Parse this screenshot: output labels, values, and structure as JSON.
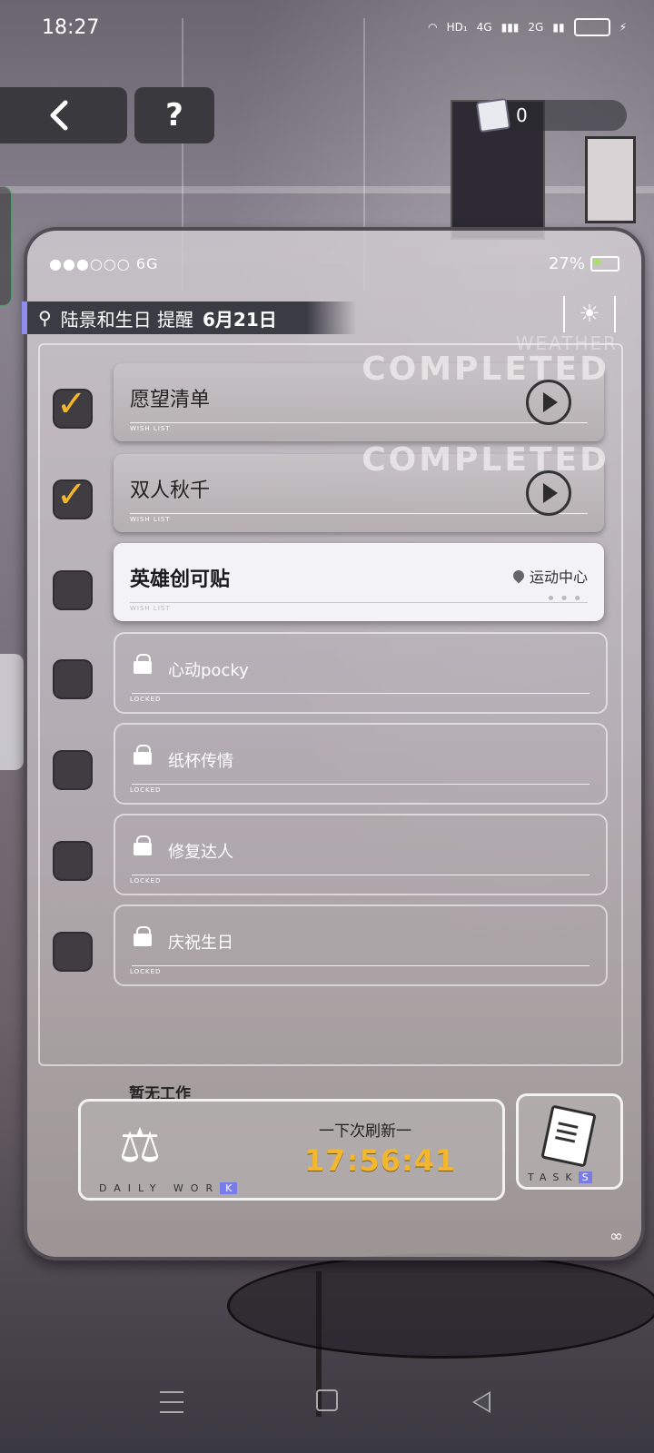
{
  "status_bar": {
    "time": "18:27",
    "network_labels": [
      "HD₁",
      "4G",
      "2G"
    ]
  },
  "top_nav": {
    "back_icon": "chevron-left-icon",
    "help_label": "?",
    "currency_value": "0"
  },
  "phone": {
    "signal_text": "●●●○○○ 6G",
    "battery_percent": "27%",
    "reminder": {
      "text": "陆景和生日 提醒",
      "date": "6月21日"
    },
    "weather_watermark": "WEATHER",
    "tasks": [
      {
        "title": "愿望清单",
        "sub": "WISH LIST",
        "state": "completed",
        "stamp": "COMPLETED"
      },
      {
        "title": "双人秋千",
        "sub": "WISH LIST",
        "state": "completed",
        "stamp": "COMPLETED"
      },
      {
        "title": "英雄创可贴",
        "sub": "WISH LIST",
        "state": "active",
        "location": "运动中心",
        "more": "•••"
      },
      {
        "title": "心动pocky",
        "sub": "LOCKED",
        "state": "locked"
      },
      {
        "title": "纸杯传情",
        "sub": "LOCKED",
        "state": "locked"
      },
      {
        "title": "修复达人",
        "sub": "LOCKED",
        "state": "locked"
      },
      {
        "title": "庆祝生日",
        "sub": "LOCKED",
        "state": "locked"
      }
    ],
    "daily_work": {
      "status": "暂无工作",
      "label_prefix": "DAILY WOR",
      "label_highlight": "K",
      "refresh_label": "一下次刷新一",
      "refresh_time": "17:56:41"
    },
    "tasks_button": {
      "label_prefix": "TASK",
      "label_highlight": "S"
    }
  }
}
